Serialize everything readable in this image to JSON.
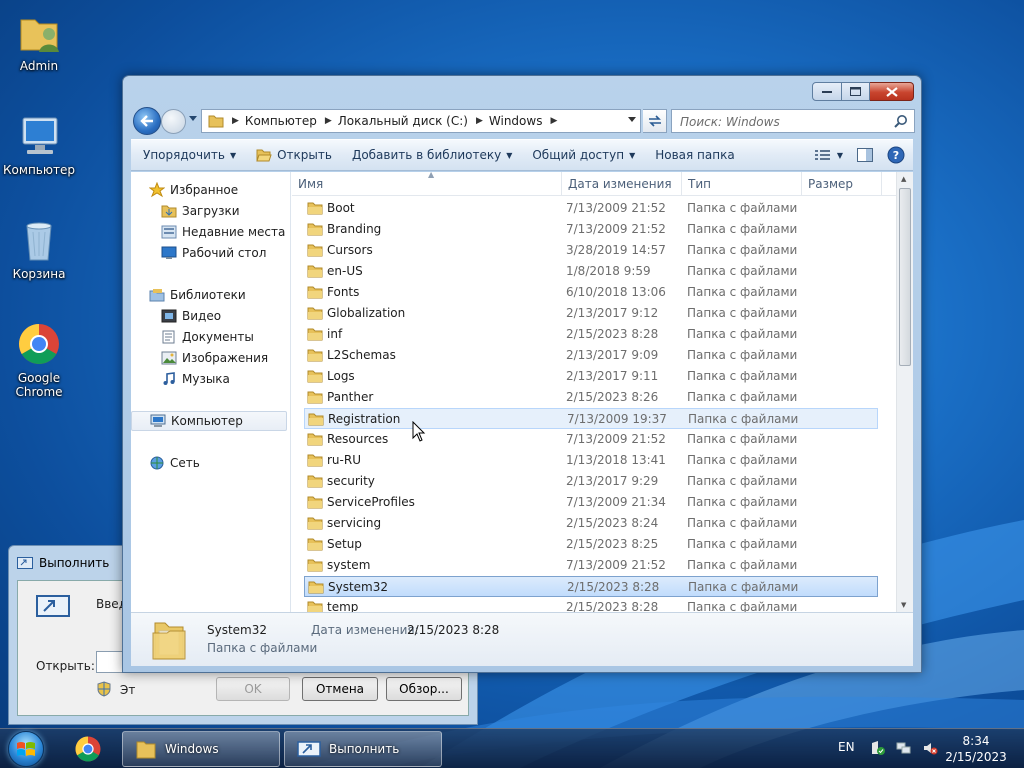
{
  "desktop": {
    "icons": [
      {
        "label": "Admin"
      },
      {
        "label": "Компьютер"
      },
      {
        "label": "Корзина"
      },
      {
        "label": "Google Chrome"
      }
    ]
  },
  "run_dialog": {
    "title": "Выполнить",
    "prompt": "Введите",
    "open_label": "Открыть:",
    "check_text": "Эт",
    "ok_label": "OK",
    "cancel_label": "Отмена",
    "browse_label": "Обзор..."
  },
  "explorer": {
    "breadcrumb": [
      "Компьютер",
      "Локальный диск (C:)",
      "Windows"
    ],
    "search_placeholder": "Поиск: Windows",
    "commands": {
      "organize": "Упорядочить",
      "open": "Открыть",
      "add_library": "Добавить в библиотеку",
      "share": "Общий доступ",
      "new_folder": "Новая папка"
    },
    "nav": {
      "favorites": "Избранное",
      "downloads": "Загрузки",
      "recent": "Недавние места",
      "desktop": "Рабочий стол",
      "libraries": "Библиотеки",
      "video": "Видео",
      "documents": "Документы",
      "images": "Изображения",
      "music": "Музыка",
      "computer": "Компьютер",
      "network": "Сеть"
    },
    "columns": {
      "name": "Имя",
      "date": "Дата изменения",
      "type": "Тип",
      "size": "Размер"
    },
    "files": [
      {
        "name": "Boot",
        "date": "7/13/2009 21:52",
        "type": "Папка с файлами"
      },
      {
        "name": "Branding",
        "date": "7/13/2009 21:52",
        "type": "Папка с файлами"
      },
      {
        "name": "Cursors",
        "date": "3/28/2019 14:57",
        "type": "Папка с файлами"
      },
      {
        "name": "en-US",
        "date": "1/8/2018 9:59",
        "type": "Папка с файлами"
      },
      {
        "name": "Fonts",
        "date": "6/10/2018 13:06",
        "type": "Папка с файлами"
      },
      {
        "name": "Globalization",
        "date": "2/13/2017 9:12",
        "type": "Папка с файлами"
      },
      {
        "name": "inf",
        "date": "2/15/2023 8:28",
        "type": "Папка с файлами"
      },
      {
        "name": "L2Schemas",
        "date": "2/13/2017 9:09",
        "type": "Папка с файлами"
      },
      {
        "name": "Logs",
        "date": "2/13/2017 9:11",
        "type": "Папка с файлами"
      },
      {
        "name": "Panther",
        "date": "2/15/2023 8:26",
        "type": "Папка с файлами"
      },
      {
        "name": "Registration",
        "date": "7/13/2009 19:37",
        "type": "Папка с файлами"
      },
      {
        "name": "Resources",
        "date": "7/13/2009 21:52",
        "type": "Папка с файлами"
      },
      {
        "name": "ru-RU",
        "date": "1/13/2018 13:41",
        "type": "Папка с файлами"
      },
      {
        "name": "security",
        "date": "2/13/2017 9:29",
        "type": "Папка с файлами"
      },
      {
        "name": "ServiceProfiles",
        "date": "7/13/2009 21:34",
        "type": "Папка с файлами"
      },
      {
        "name": "servicing",
        "date": "2/15/2023 8:24",
        "type": "Папка с файлами"
      },
      {
        "name": "Setup",
        "date": "2/15/2023 8:25",
        "type": "Папка с файлами"
      },
      {
        "name": "system",
        "date": "7/13/2009 21:52",
        "type": "Папка с файлами"
      },
      {
        "name": "System32",
        "date": "2/15/2023 8:28",
        "type": "Папка с файлами"
      },
      {
        "name": "temp",
        "date": "2/15/2023 8:28",
        "type": "Папка с файлами"
      }
    ],
    "details": {
      "name": "System32",
      "type": "Папка с файлами",
      "date_label": "Дата изменения:",
      "date_value": "2/15/2023 8:28"
    }
  },
  "taskbar": {
    "tasks": [
      {
        "label": "Windows"
      },
      {
        "label": "Выполнить"
      }
    ],
    "lang": "EN",
    "time": "8:34",
    "date": "2/15/2023"
  }
}
